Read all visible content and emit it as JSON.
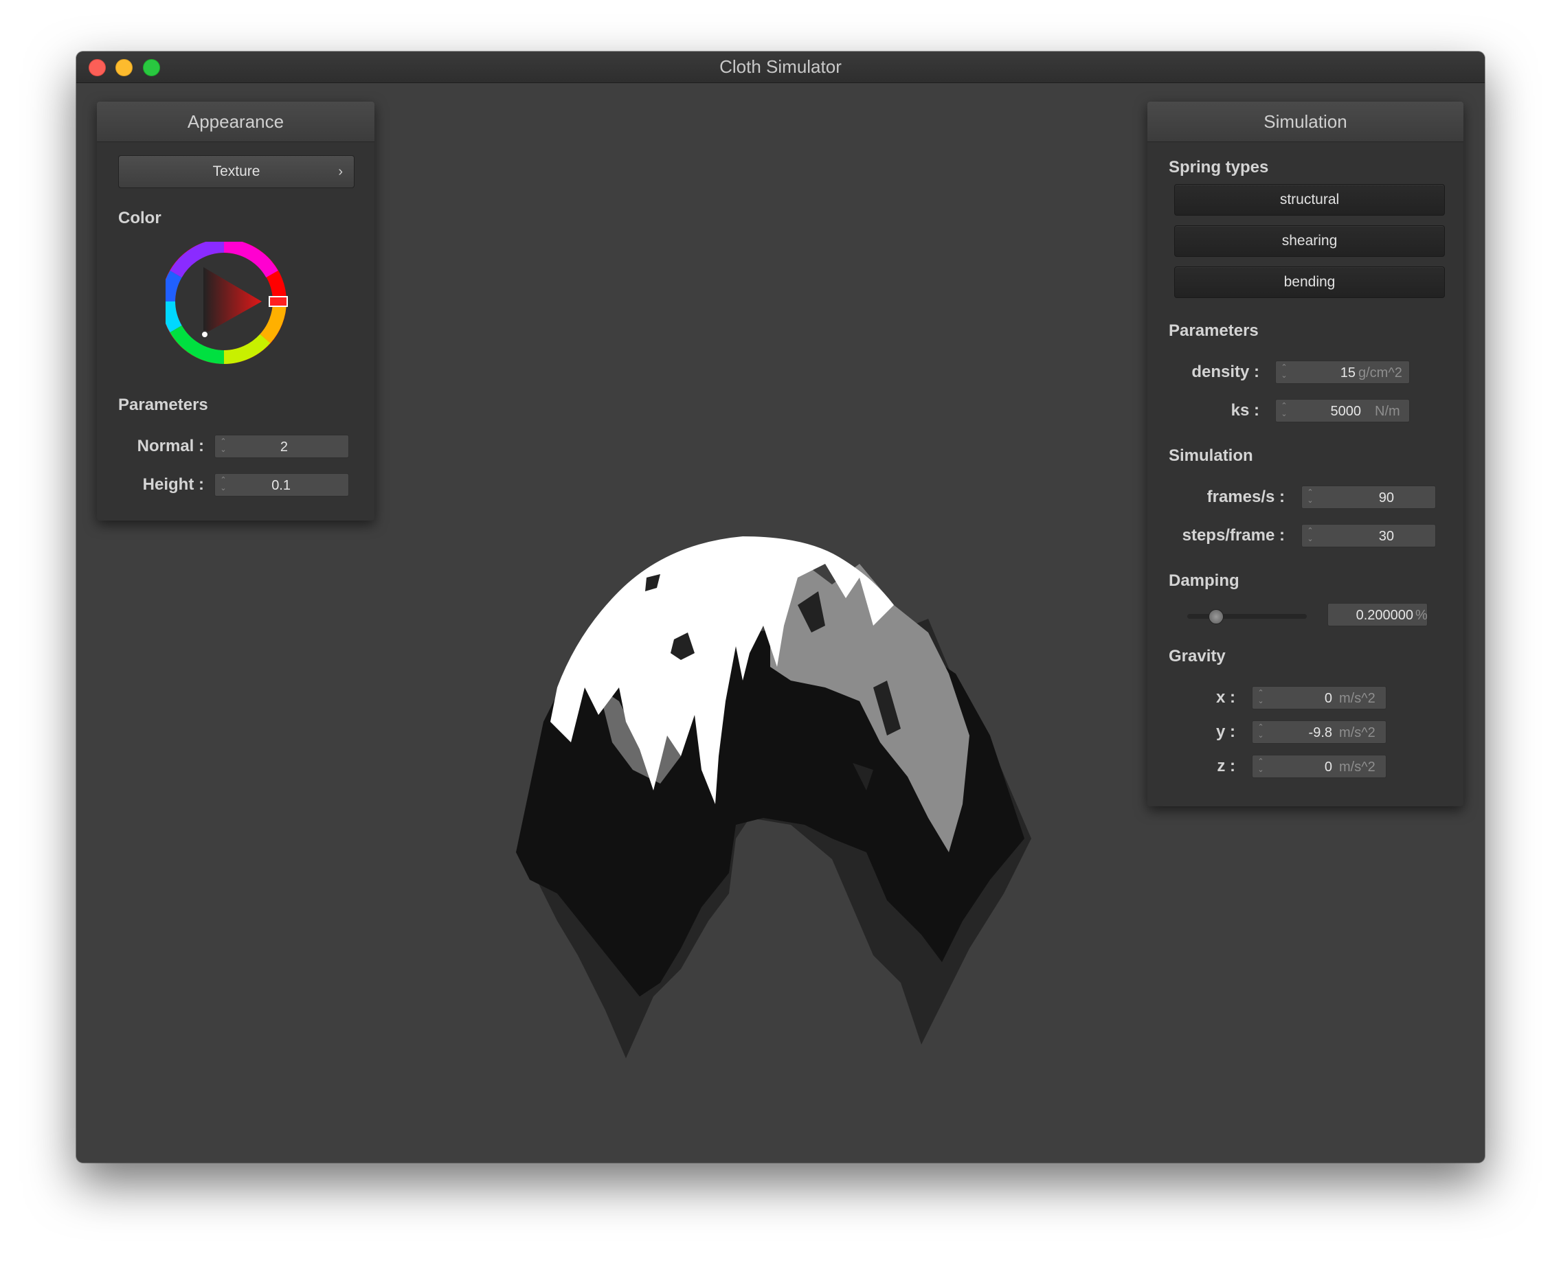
{
  "window": {
    "title": "Cloth Simulator"
  },
  "appearance": {
    "title": "Appearance",
    "texture_button": "Texture",
    "texture_chevron": "›",
    "color_label": "Color",
    "color_value": "#ff0000",
    "parameters_label": "Parameters",
    "normal": {
      "label": "Normal :",
      "value": "2"
    },
    "height": {
      "label": "Height :",
      "value": "0.1"
    }
  },
  "simulation": {
    "title": "Simulation",
    "spring_types_label": "Spring types",
    "spring_types": [
      "structural",
      "shearing",
      "bending"
    ],
    "parameters_label": "Parameters",
    "density": {
      "label": "density :",
      "value": "15",
      "unit": "g/cm^2"
    },
    "ks": {
      "label": "ks :",
      "value": "5000",
      "unit": "N/m"
    },
    "simulation_label": "Simulation",
    "frames_per_s": {
      "label": "frames/s :",
      "value": "90"
    },
    "steps_per_frame": {
      "label": "steps/frame :",
      "value": "30"
    },
    "damping_label": "Damping",
    "damping": {
      "slider_fraction": 0.2,
      "value": "0.200000",
      "unit": "%"
    },
    "gravity_label": "Gravity",
    "gravity": [
      {
        "label": "x :",
        "value": "0",
        "unit": "m/s^2"
      },
      {
        "label": "y :",
        "value": "-9.8",
        "unit": "m/s^2"
      },
      {
        "label": "z :",
        "value": "0",
        "unit": "m/s^2"
      }
    ]
  },
  "icons": {
    "spinner": "up-down-arrows-icon",
    "chevron": "chevron-right-icon"
  }
}
